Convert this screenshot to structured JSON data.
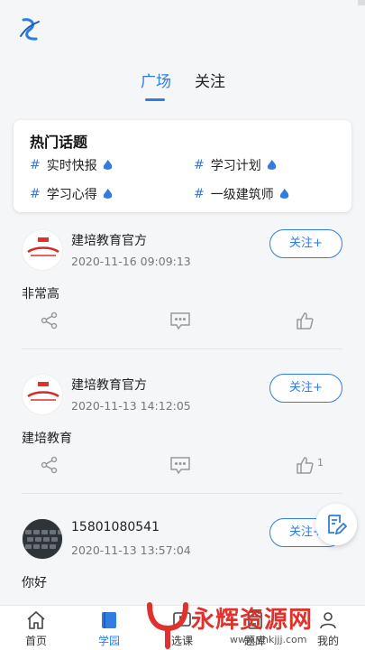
{
  "tabs": [
    {
      "label": "广场",
      "active": true
    },
    {
      "label": "关注",
      "active": false
    }
  ],
  "hot_topics": {
    "title": "热门话题",
    "hash": "#",
    "items": [
      {
        "label": "实时快报"
      },
      {
        "label": "学习计划"
      },
      {
        "label": "学习心得"
      },
      {
        "label": "一级建筑师"
      }
    ]
  },
  "posts": [
    {
      "author": "建培教育官方",
      "time": "2020-11-16 09:09:13",
      "content": "非常高",
      "follow_label": "关注+",
      "like_count": "",
      "avatar": "brand-logo"
    },
    {
      "author": "建培教育官方",
      "time": "2020-11-13 14:12:05",
      "content": "建培教育",
      "follow_label": "关注+",
      "like_count": "1",
      "avatar": "brand-logo"
    },
    {
      "author": "15801080541",
      "time": "2020-11-13 13:57:04",
      "content": "你好",
      "follow_label": "关注+",
      "like_count": "",
      "avatar": "keyboard-photo"
    }
  ],
  "bottom_nav": [
    {
      "label": "首页",
      "icon": "home-icon",
      "active": false
    },
    {
      "label": "学园",
      "icon": "book-icon",
      "active": true
    },
    {
      "label": "选课",
      "icon": "course-icon",
      "active": false
    },
    {
      "label": "题库",
      "icon": "question-bank-icon",
      "active": false
    },
    {
      "label": "我的",
      "icon": "profile-icon",
      "active": false
    }
  ],
  "watermark": {
    "text": "永辉资源网",
    "url": "www.yhkjjj.com"
  },
  "colors": {
    "accent": "#2f7de1",
    "hot_badge": "#2f7de1",
    "watermark": "#e0312d"
  }
}
